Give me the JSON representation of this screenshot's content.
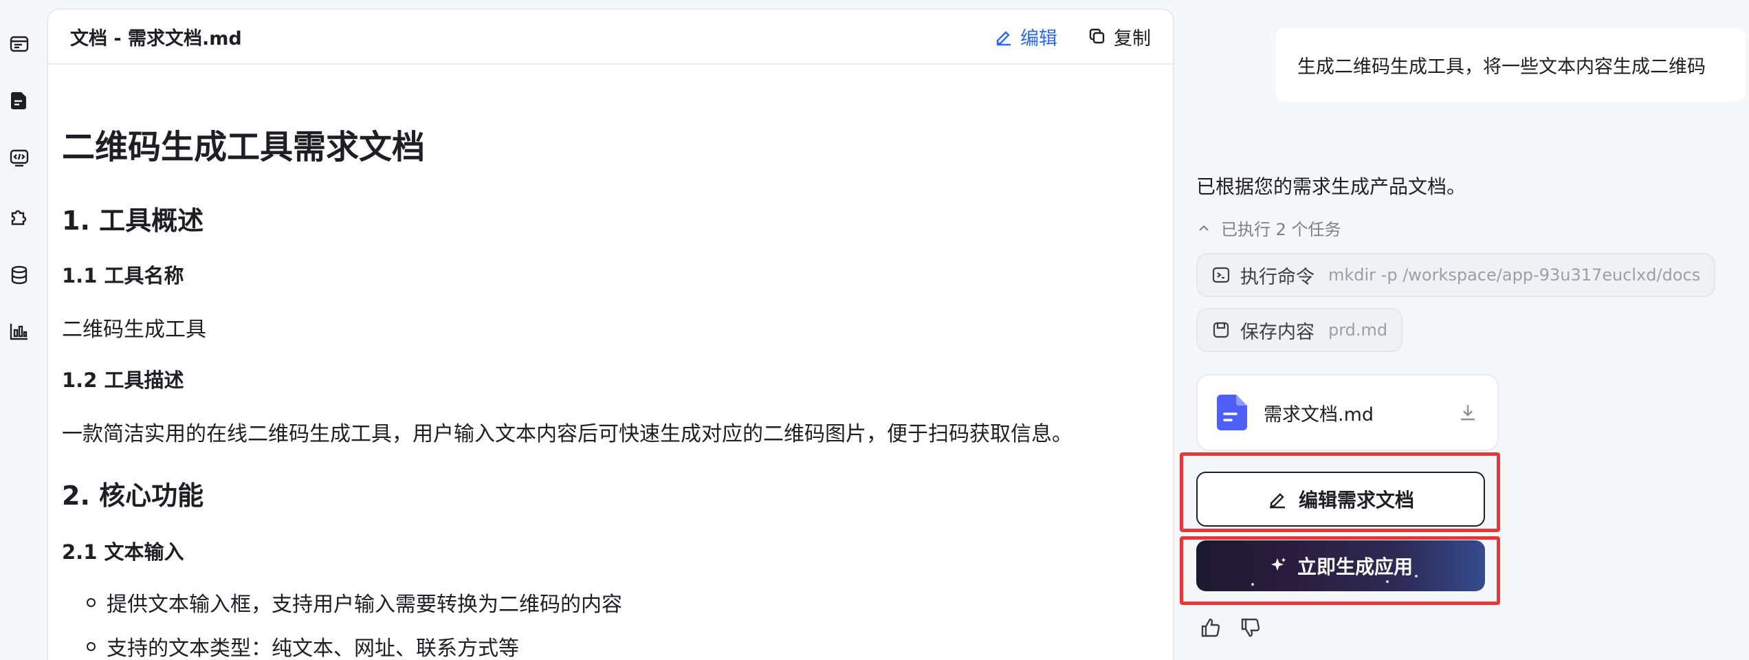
{
  "rail": {
    "items": [
      "browser-icon",
      "document-icon",
      "code-icon",
      "puzzle-icon",
      "database-icon",
      "chart-icon"
    ]
  },
  "doc": {
    "title": "文档 - 需求文档.md",
    "edit_label": "编辑",
    "copy_label": "复制",
    "h1": "二维码生成工具需求文档",
    "s1_title": "1. 工具概述",
    "s1_1_title": "1.1 工具名称",
    "s1_1_text": "二维码生成工具",
    "s1_2_title": "1.2 工具描述",
    "s1_2_text": "一款简洁实用的在线二维码生成工具，用户输入文本内容后可快速生成对应的二维码图片，便于扫码获取信息。",
    "s2_title": "2. 核心功能",
    "s2_1_title": "2.1 文本输入",
    "s2_1_items": [
      "提供文本输入框，支持用户输入需要转换为二维码的内容",
      "支持的文本类型：纯文本、网址、联系方式等"
    ]
  },
  "chat": {
    "user_message": "生成二维码生成工具，将一些文本内容生成二维码",
    "ai_message": "已根据您的需求生成产品文档。",
    "tasks_label": "已执行 2 个任务",
    "tasks": [
      {
        "label": "执行命令",
        "detail": "mkdir -p /workspace/app-93u317euclxd/docs"
      },
      {
        "label": "保存内容",
        "detail": "prd.md"
      }
    ],
    "file_name": "需求文档.md",
    "edit_doc_button": "编辑需求文档",
    "generate_button": "立即生成应用"
  },
  "colors": {
    "accent": "#2b6af3",
    "highlight": "#e5383b",
    "file_icon": "#4f5ef7"
  }
}
